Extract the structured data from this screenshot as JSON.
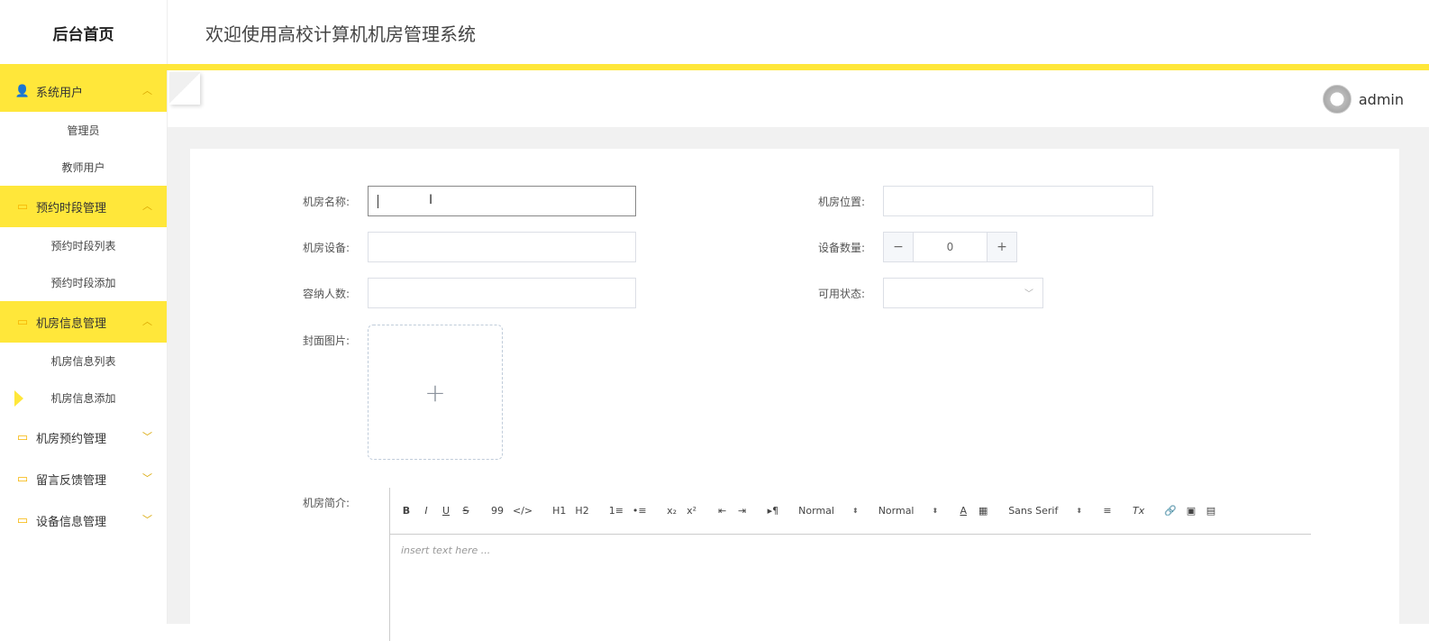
{
  "brand": "后台首页",
  "welcome": "欢迎使用高校计算机机房管理系统",
  "user": {
    "name": "admin"
  },
  "sidebar": {
    "groups": [
      {
        "label": "系统用户",
        "icon": "user-icon",
        "expanded": true,
        "items": [
          "管理员",
          "教师用户"
        ]
      },
      {
        "label": "预约时段管理",
        "icon": "folder-icon",
        "expanded": true,
        "items": [
          "预约时段列表",
          "预约时段添加"
        ]
      },
      {
        "label": "机房信息管理",
        "icon": "folder-icon",
        "expanded": true,
        "items": [
          "机房信息列表",
          "机房信息添加"
        ]
      },
      {
        "label": "机房预约管理",
        "icon": "folder-icon",
        "expanded": false,
        "items": []
      },
      {
        "label": "留言反馈管理",
        "icon": "folder-icon",
        "expanded": false,
        "items": []
      },
      {
        "label": "设备信息管理",
        "icon": "folder-icon",
        "expanded": false,
        "items": []
      }
    ],
    "active_item": "机房信息添加"
  },
  "form": {
    "room_name_label": "机房名称:",
    "room_location_label": "机房位置:",
    "room_equipment_label": "机房设备:",
    "equipment_count_label": "设备数量:",
    "equipment_count_value": "0",
    "capacity_label": "容纳人数:",
    "status_label": "可用状态:",
    "cover_label": "封面图片:",
    "intro_label": "机房简介:",
    "room_name_value": "",
    "room_location_value": "",
    "room_equipment_value": "",
    "capacity_value": "",
    "status_value": ""
  },
  "editor": {
    "placeholder": "insert text here ...",
    "heading_select": "Normal",
    "size_select": "Normal",
    "font_select": "Sans Serif",
    "buttons": {
      "bold": "B",
      "italic": "I",
      "underline": "U",
      "strike": "S",
      "quote": "99",
      "code": "</>",
      "h1": "H1",
      "h2": "H2",
      "ol": "1≡",
      "ul": "•≡",
      "sub": "x₂",
      "sup": "x²",
      "outdent": "⇤",
      "indent": "⇥",
      "rtl": "▸¶",
      "color": "A",
      "bg": "▦",
      "align": "≡",
      "clean": "Tx",
      "link": "🔗",
      "image": "▣",
      "video": "▤"
    }
  },
  "colors": {
    "accent": "#ffe73a",
    "background": "#f1f1f1"
  }
}
